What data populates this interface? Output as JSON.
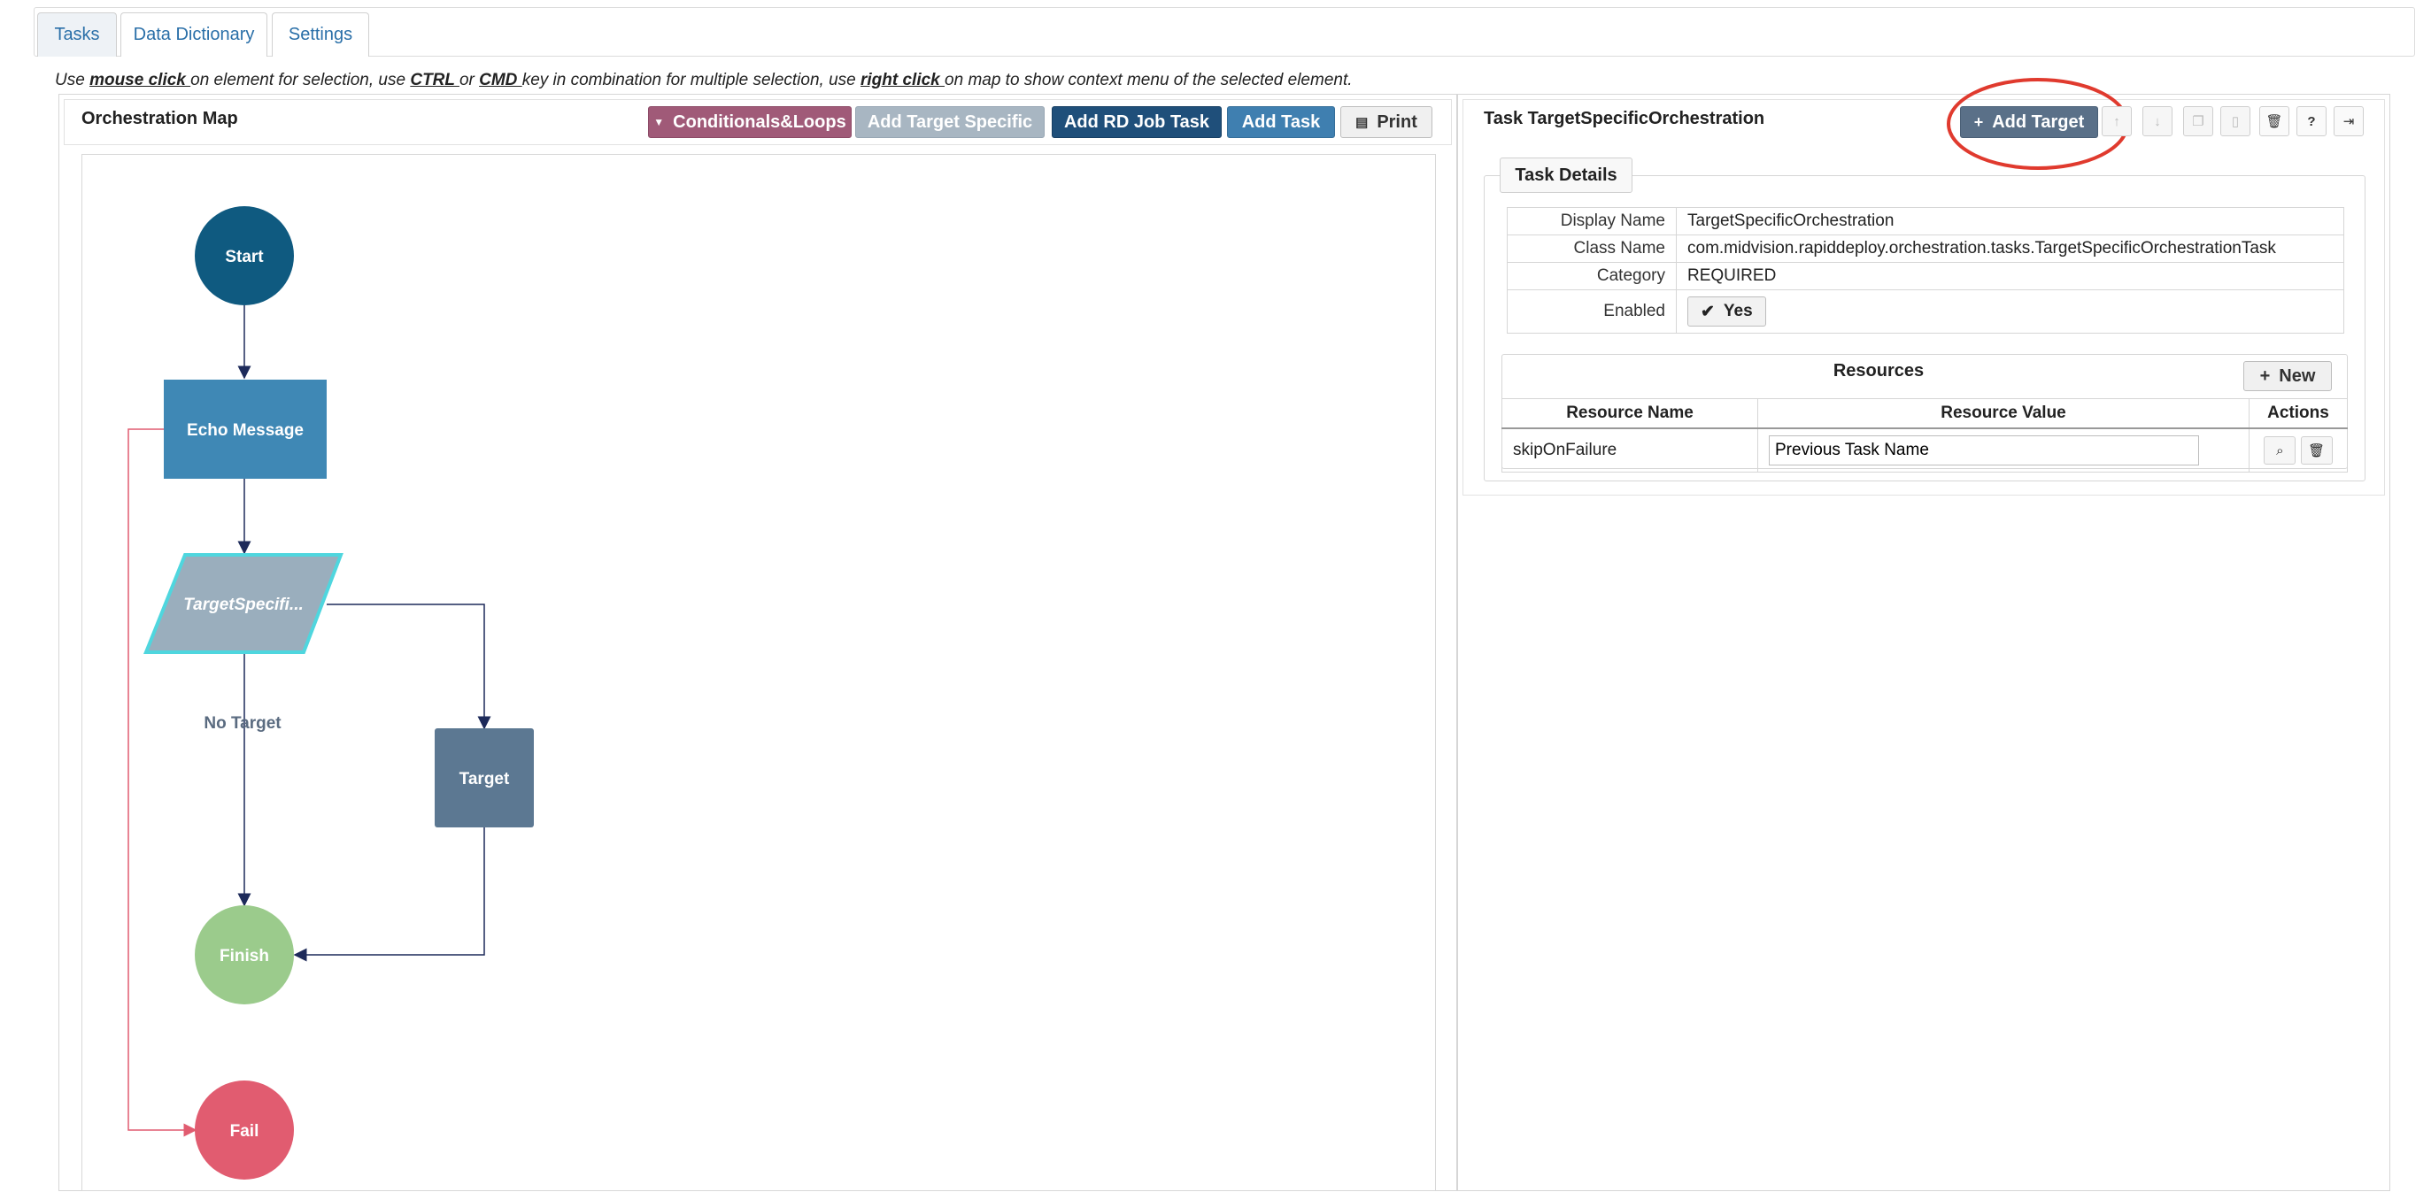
{
  "tabs": [
    "Tasks",
    "Data Dictionary",
    "Settings"
  ],
  "hint": {
    "p1": "Use ",
    "b1": "mouse click ",
    "p2": "on element for selection, use ",
    "b2": "CTRL ",
    "p3": "or ",
    "b3": "CMD ",
    "p4": "key in combination for multiple selection, use ",
    "b4": "right click ",
    "p5": "on map to show context menu of the selected element."
  },
  "map": {
    "title": "Orchestration Map",
    "buttons": {
      "conditionals": "Conditionals&Loops",
      "add_target_specific": "Add Target Specific",
      "add_rd_job": "Add RD Job Task",
      "add_task": "Add Task",
      "print": "Print"
    },
    "nodes": {
      "start": "Start",
      "echo": "Echo Message",
      "target_specific": "TargetSpecifi...",
      "target": "Target",
      "finish": "Finish",
      "fail": "Fail"
    },
    "edge_label": "No Target"
  },
  "task": {
    "title": "Task TargetSpecificOrchestration",
    "add_target": "Add Target",
    "details_tab": "Task Details",
    "rows": [
      {
        "label": "Display Name",
        "value": "TargetSpecificOrchestration"
      },
      {
        "label": "Class Name",
        "value": "com.midvision.rapiddeploy.orchestration.tasks.TargetSpecificOrchestrationTask"
      },
      {
        "label": "Category",
        "value": "REQUIRED"
      }
    ],
    "enabled_label": "Enabled",
    "enabled_value": "Yes",
    "resources": {
      "title": "Resources",
      "new_button": "New",
      "headers": [
        "Resource Name",
        "Resource Value",
        "Actions"
      ],
      "rows": [
        {
          "name": "skipOnFailure",
          "value": "Previous Task Name"
        }
      ]
    }
  },
  "colors": {
    "start": "#0f5a80",
    "echo": "#3f88b5",
    "target_specific": "#9aaebd",
    "target": "#5c7892",
    "finish": "#9bcb8c",
    "fail": "#e15c70",
    "highlight": "#e03a2e"
  }
}
